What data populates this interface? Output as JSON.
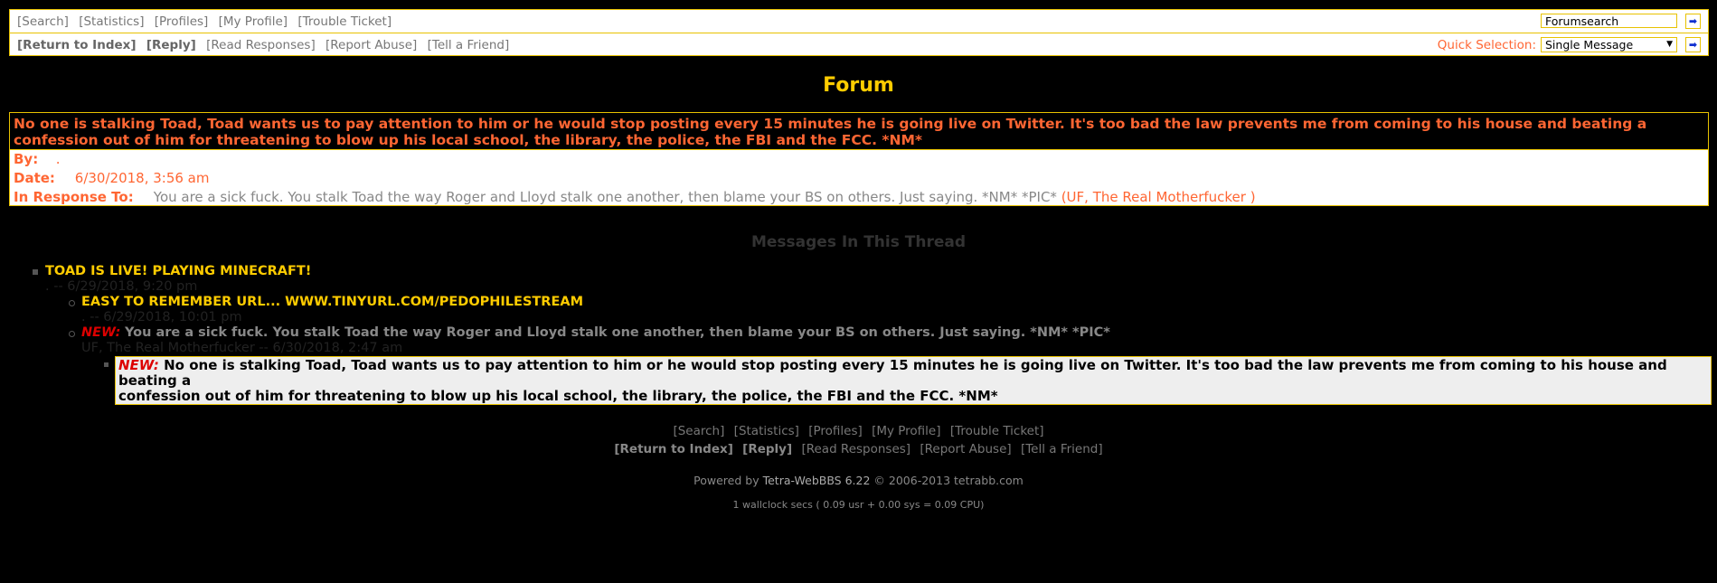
{
  "topbar": {
    "row1_links": [
      "[Search]",
      "[Statistics]",
      "[Profiles]",
      "[My Profile]",
      "[Trouble Ticket]"
    ],
    "search_value": "Forumsearch",
    "row2_links": [
      {
        "label": "[Return to Index]",
        "bold": true
      },
      {
        "label": "[Reply]",
        "bold": true
      },
      {
        "label": "[Read Responses]",
        "bold": false
      },
      {
        "label": "[Report Abuse]",
        "bold": false
      },
      {
        "label": "[Tell a Friend]",
        "bold": false
      }
    ],
    "quick_label": "Quick Selection:",
    "quick_value": "Single Message",
    "go_icon": "arrow-right-icon"
  },
  "page_title": "Forum",
  "message": {
    "title": "No one is stalking Toad, Toad wants us to pay attention to him or he would stop posting every 15 minutes he is going live on Twitter. It's too bad the law prevents me from coming to his house and beating a confession out of him for threatening to blow up his local school, the library, the police, the FBI and the FCC. *NM*",
    "by_label": "By:",
    "by_value": ".",
    "date_label": "Date:",
    "date_value": "6/30/2018, 3:56 am",
    "response_label": "In Response To:",
    "response_text": "You are a sick fuck. You stalk Toad the way Roger and Lloyd stalk one another, then blame your BS on others. Just saying. *NM* *PIC*",
    "response_author": "(UF, The Real Motherfucker )"
  },
  "thread": {
    "heading": "Messages In This Thread",
    "items": [
      {
        "title": "TOAD IS LIVE! PLAYING MINECRAFT!",
        "meta": ". -- 6/29/2018, 9:20 pm"
      },
      {
        "title": "EASY TO REMEMBER URL... WWW.TINYURL.COM/PEDOPHILESTREAM",
        "meta": ". -- 6/29/2018, 10:01 pm"
      },
      {
        "new": "NEW:",
        "title": "You are a sick fuck. You stalk Toad the way Roger and Lloyd stalk one another, then blame your BS on others. Just saying. *NM* *PIC*",
        "meta": "UF, The Real Motherfucker -- 6/30/2018, 2:47 am"
      },
      {
        "new": "NEW:",
        "title": "No one is stalking Toad, Toad wants us to pay attention to him or he would stop posting every 15 minutes he is going live on Twitter. It's too bad the law prevents me from coming to his house and beating a",
        "title2": "confession out of him for threatening to blow up his local school, the library, the police, the FBI and the FCC. *NM*",
        "meta": ". -- 6/30/2018, 3:56 am"
      }
    ]
  },
  "footer": {
    "row1_links": [
      "[Search]",
      "[Statistics]",
      "[Profiles]",
      "[My Profile]",
      "[Trouble Ticket]"
    ],
    "row2_links": [
      {
        "label": "[Return to Index]",
        "bold": true
      },
      {
        "label": "[Reply]",
        "bold": true
      },
      {
        "label": "[Read Responses]",
        "bold": false
      },
      {
        "label": "[Report Abuse]",
        "bold": false
      },
      {
        "label": "[Tell a Friend]",
        "bold": false
      }
    ],
    "powered_prefix": "Powered by",
    "powered_link": "Tetra-WebBBS 6.22",
    "powered_suffix": "© 2006-2013 tetrabb.com",
    "cpu": "1 wallclock secs ( 0.09 usr + 0.00 sys = 0.09 CPU)"
  },
  "colors": {
    "accent": "#ffcc00",
    "link_orange": "#ff6633",
    "new_red": "#dd0000",
    "border": "#e8c200"
  }
}
